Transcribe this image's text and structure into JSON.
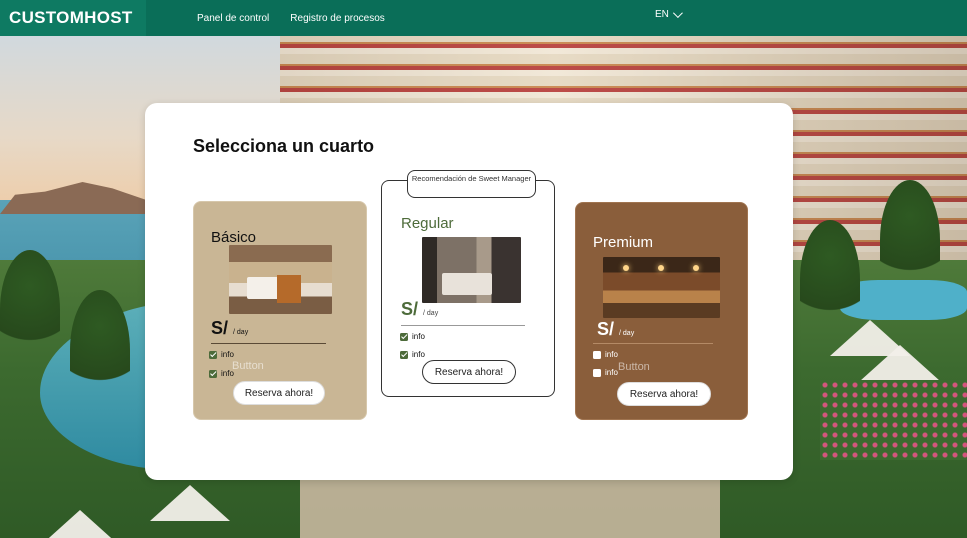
{
  "header": {
    "brand": "CUSTOMHOST",
    "nav": [
      "Panel de control",
      "Registro de procesos"
    ],
    "language": "EN"
  },
  "panel": {
    "title": "Selecciona un cuarto"
  },
  "cards": {
    "basic": {
      "name": "Básico",
      "currency": "S/",
      "per": "/ day",
      "info": [
        "info",
        "info"
      ],
      "ghost": "Button",
      "button": "Reserva ahora!"
    },
    "regular": {
      "recommendation": "Recomendación de Sweet Manager",
      "name": "Regular",
      "currency": "S/",
      "per": "/ day",
      "info": [
        "info",
        "info"
      ],
      "button": "Reserva ahora!"
    },
    "premium": {
      "name": "Premium",
      "currency": "S/",
      "per": "/ day",
      "info": [
        "info",
        "info"
      ],
      "ghost": "Button",
      "button": "Reserva ahora!"
    }
  },
  "colors": {
    "topbar": "#0a6e58",
    "basic_card": "#c9b695",
    "premium_card": "#8a5e3b",
    "accent_green": "#4d6b3a"
  },
  "icons": {
    "language": "chevron-down-icon",
    "info": "checkbox-icon"
  }
}
